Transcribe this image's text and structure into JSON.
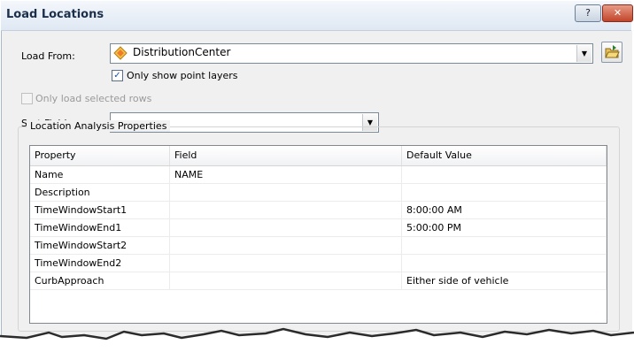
{
  "window": {
    "title": "Load Locations",
    "help_label": "?",
    "close_label": "✕"
  },
  "load_from": {
    "label": "Load From:",
    "value": "DistributionCenter",
    "layer_icon": "point-layer-icon",
    "open_icon": "open-folder-icon"
  },
  "only_point_layers": {
    "label": "Only show point layers",
    "checked": true
  },
  "only_selected_rows": {
    "label": "Only load selected rows",
    "checked": false,
    "enabled": false
  },
  "sort_field": {
    "label": "Sort Field:",
    "value": ""
  },
  "analysis": {
    "group_label": "Location Analysis Properties",
    "columns": [
      "Property",
      "Field",
      "Default Value"
    ],
    "rows": [
      {
        "property": "Name",
        "field": "NAME",
        "default": ""
      },
      {
        "property": "Description",
        "field": "",
        "default": ""
      },
      {
        "property": "TimeWindowStart1",
        "field": "",
        "default": "8:00:00 AM"
      },
      {
        "property": "TimeWindowEnd1",
        "field": "",
        "default": "5:00:00 PM"
      },
      {
        "property": "TimeWindowStart2",
        "field": "",
        "default": ""
      },
      {
        "property": "TimeWindowEnd2",
        "field": "",
        "default": ""
      },
      {
        "property": "CurbApproach",
        "field": "",
        "default": "Either side of vehicle"
      }
    ]
  },
  "colors": {
    "accent_check": "#1c4fb0",
    "close_button": "#c2452a",
    "title_text": "#1b2f4a"
  }
}
